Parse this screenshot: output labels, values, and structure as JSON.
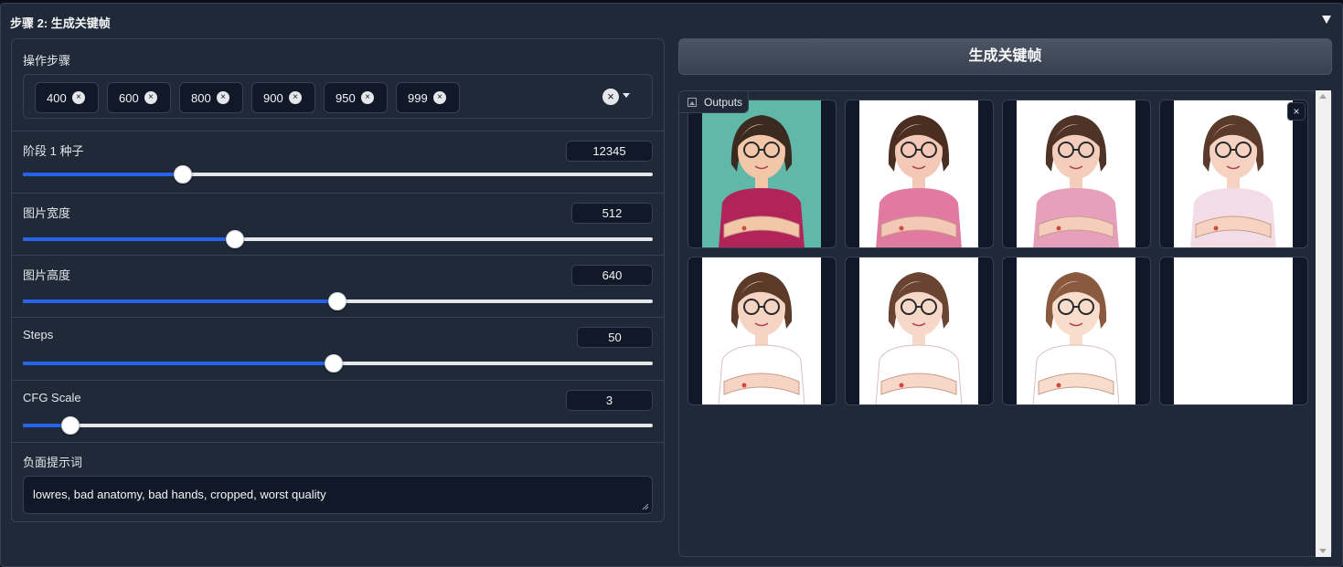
{
  "accordion": {
    "title": "步骤 2: 生成关键帧"
  },
  "operations": {
    "label": "操作步骤",
    "tokens": [
      "400",
      "600",
      "800",
      "900",
      "950",
      "999"
    ],
    "token_remove": "×",
    "clear_icon": "×"
  },
  "sliders": {
    "seed": {
      "label": "阶段 1 种子",
      "value": "12345",
      "fraction": 0.254
    },
    "width": {
      "label": "图片宽度",
      "value": "512",
      "fraction": 0.336
    },
    "height": {
      "label": "图片高度",
      "value": "640",
      "fraction": 0.499
    },
    "steps": {
      "label": "Steps",
      "value": "50",
      "fraction": 0.494
    },
    "cfg": {
      "label": "CFG Scale",
      "value": "3",
      "fraction": 0.076
    }
  },
  "negative_prompt": {
    "label": "负面提示词",
    "value": "lowres, bad anatomy, bad hands, cropped, worst quality"
  },
  "generate_button": {
    "label": "生成关键帧"
  },
  "gallery": {
    "label": "Outputs",
    "close_icon": "×",
    "images": [
      {
        "name": "keyframe-1",
        "bg": "#5fb8a8",
        "shirt": "#b0245a",
        "skin": "#f2c7a8",
        "hair": "#3a2a20"
      },
      {
        "name": "keyframe-2",
        "bg": "#ffffff",
        "shirt": "#e07aa0",
        "skin": "#f4c8b6",
        "hair": "#4a2e22"
      },
      {
        "name": "keyframe-3",
        "bg": "#ffffff",
        "shirt": "#e6a0bc",
        "skin": "#f4cdbd",
        "hair": "#4e3426"
      },
      {
        "name": "keyframe-4",
        "bg": "#ffffff",
        "shirt": "#f2dde6",
        "skin": "#f6d2c2",
        "hair": "#5a3a2a"
      },
      {
        "name": "keyframe-5",
        "bg": "#ffffff",
        "shirt": "#ffffff",
        "skin": "#f6d4c4",
        "hair": "#5c3a2a"
      },
      {
        "name": "keyframe-6",
        "bg": "#ffffff",
        "shirt": "#ffffff",
        "skin": "#f7d8c8",
        "hair": "#6a4432"
      },
      {
        "name": "keyframe-7",
        "bg": "#ffffff",
        "shirt": "#ffffff",
        "skin": "#f8dccc",
        "hair": "#8a5a40"
      },
      {
        "name": "keyframe-8",
        "bg": "#ffffff",
        "shirt": "#ffffff",
        "skin": "#ffffff",
        "hair": "#ffffff"
      }
    ]
  },
  "colors": {
    "accent": "#2563eb",
    "panel": "#1f2937",
    "border": "#374151"
  }
}
